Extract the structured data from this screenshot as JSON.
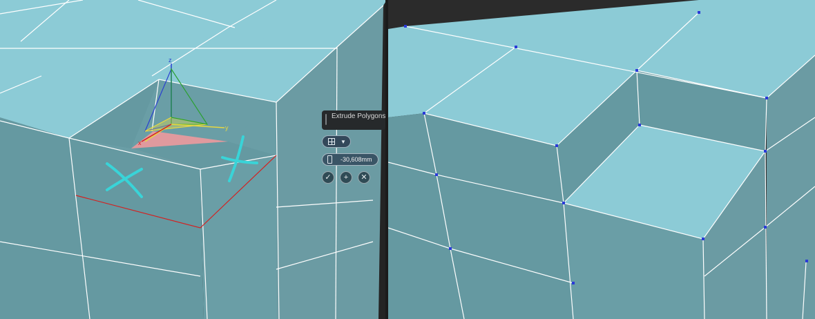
{
  "caddy": {
    "title": "Extrude Polygons",
    "extrusion_type_icon": "grid-icon",
    "height_value": "-30,608mm",
    "ok_icon": "check-icon",
    "apply_icon": "plus-icon",
    "cancel_icon": "x-icon"
  },
  "gizmo": {
    "x_label": "x",
    "y_label": "y",
    "z_label": "z"
  },
  "colors": {
    "face_top": "#8ccbd6",
    "face_side": "#6599a1",
    "selected_face": "#e09a9e",
    "annotation": "#39d4d8",
    "edge": "#ffffff",
    "selected_edge": "#d42020",
    "vertex": "#2a3ad8"
  }
}
